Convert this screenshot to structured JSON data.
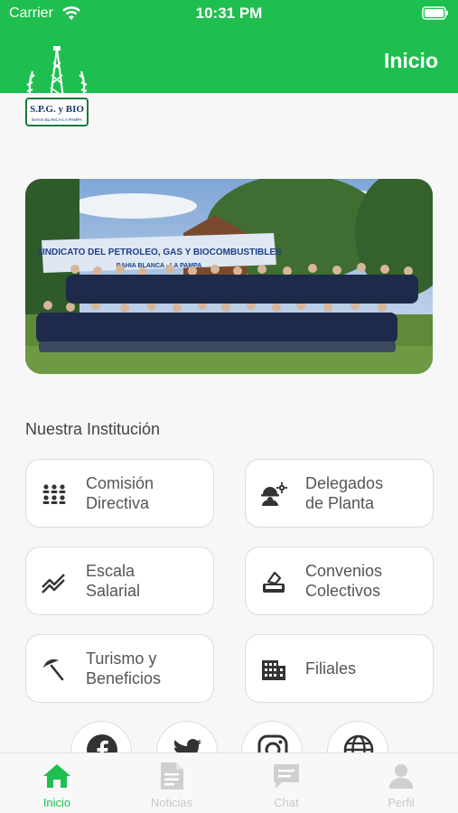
{
  "status_bar": {
    "carrier": "Carrier",
    "time": "10:31 PM"
  },
  "header": {
    "title": "Inicio",
    "logo_text": "S.P.G. y BIO",
    "logo_subtext": "BAHIA BLANCA-LA PAMPA",
    "accent_color": "#1fbf4f"
  },
  "photo": {
    "banner_text": "SINDICATO DEL PETROLEO, GAS Y BIOCOMBUSTIBLES",
    "banner_subtext": "BAHIA BLANCA - LA PAMPA"
  },
  "institution": {
    "title": "Nuestra Institución",
    "items": [
      {
        "label_line1": "Comisión",
        "label_line2": "Directiva",
        "icon": "group-icon"
      },
      {
        "label_line1": "Delegados",
        "label_line2": "de Planta",
        "icon": "worker-gear-icon"
      },
      {
        "label_line1": "Escala",
        "label_line2": "Salarial",
        "icon": "trend-icon"
      },
      {
        "label_line1": "Convenios",
        "label_line2": "Colectivos",
        "icon": "document-sign-icon"
      },
      {
        "label_line1": "Turismo y",
        "label_line2": "Beneficios",
        "icon": "beach-umbrella-icon"
      },
      {
        "label_line1": "Filiales",
        "label_line2": "",
        "icon": "building-icon"
      }
    ]
  },
  "social": [
    "facebook-icon",
    "twitter-icon",
    "instagram-icon",
    "globe-icon"
  ],
  "tabbar": {
    "tabs": [
      {
        "label": "Inicio",
        "icon": "home-icon",
        "active": true
      },
      {
        "label": "Noticias",
        "icon": "news-icon",
        "active": false
      },
      {
        "label": "Chat",
        "icon": "chat-icon",
        "active": false
      },
      {
        "label": "Perfil",
        "icon": "profile-icon",
        "active": false
      }
    ]
  }
}
